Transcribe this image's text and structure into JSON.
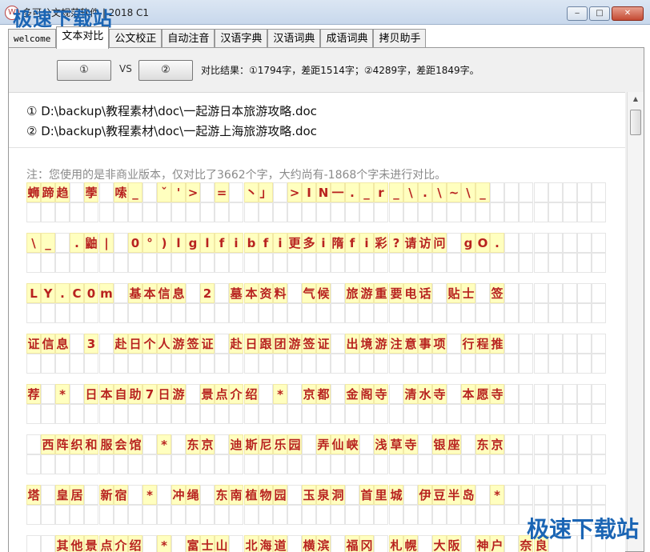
{
  "window": {
    "title": "多可公文规范软件 | 2018 C1",
    "app_icon_text": "W",
    "watermark_top": "极速下载站",
    "watermark_bottom": "极速下载站",
    "min_glyph": "‒",
    "max_glyph": "□",
    "close_glyph": "✕"
  },
  "tabs": [
    {
      "label": "welcome"
    },
    {
      "label": "文本对比",
      "active": true
    },
    {
      "label": "公文校正"
    },
    {
      "label": "自动注音"
    },
    {
      "label": "汉语字典"
    },
    {
      "label": "汉语词典"
    },
    {
      "label": "成语词典"
    },
    {
      "label": "拷贝助手"
    }
  ],
  "compare": {
    "btn1": "①",
    "vs": "VS",
    "btn2": "②",
    "result": "对比结果：①1794字，差距1514字；②4289字，差距1849字。"
  },
  "document": {
    "path1": "① D:\\backup\\教程素材\\doc\\一起游日本旅游攻略.doc",
    "path2": "② D:\\backup\\教程素材\\doc\\一起游上海旅游攻略.doc",
    "note": "注：您使用的是非商业版本，仅对比了3662个字，大约尚有-1868个字未进行对比。",
    "rows": [
      "蛳蹄趋 荸 嗦_ ˇ'> = 丶」 >IN一._r_\\.\\~\\_",
      "\\_ .鼬| 0°)lglfibfi更多i隋fi彩?请访问 gO.",
      "LY.C0m 基本信息 2 墓本资料 气候 旅游重要电话 贴士 签",
      "证信息 3 赴日个人游签证 赴日跟团游签证 出境游注意事项 行程推",
      "荐 * 日本自助7日游 景点介绍 * 京都 金阁寺 清水寺 本愿寺",
      " 西阵织和服会馆 * 东京 迪斯尼乐园 弄仙峡 浅草寺 银座 东京",
      "塔 皇居 新宿 * 冲绳 东南植物园 玉泉洞 首里城 伊豆半岛 *",
      "  其他景点介绍 * 富士山 北海道 横滨 福冈 札幌 大阪 神户 奈良"
    ]
  }
}
